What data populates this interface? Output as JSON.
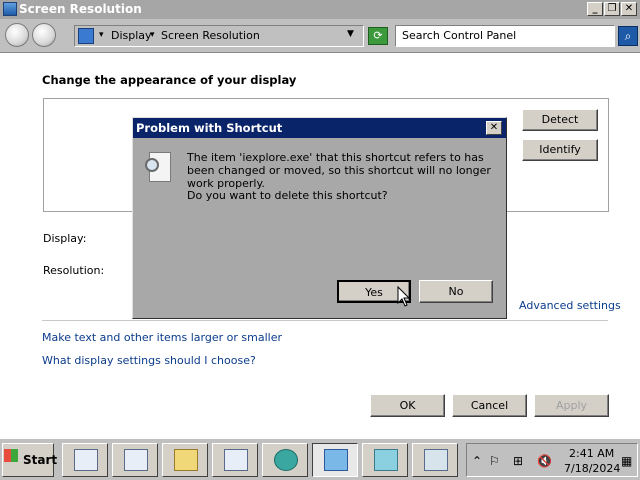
{
  "window": {
    "title": "Screen Resolution",
    "controls": {
      "minimize": "_",
      "maximize": "❐",
      "close": "✕"
    }
  },
  "toolbar": {
    "breadcrumb": [
      "Display",
      "Screen Resolution"
    ],
    "search_placeholder": "Search Control Panel"
  },
  "main": {
    "heading": "Change the appearance of your display",
    "detect_label": "Detect",
    "identify_label": "Identify",
    "display_label": "Display:",
    "resolution_label": "Resolution:",
    "advanced_link": "Advanced settings",
    "links": [
      "Make text and other items larger or smaller",
      "What display settings should I choose?"
    ],
    "ok_label": "OK",
    "cancel_label": "Cancel",
    "apply_label": "Apply"
  },
  "dialog": {
    "title": "Problem with Shortcut",
    "close": "✕",
    "message": "The item 'iexplore.exe' that this shortcut refers to has been changed or moved, so this shortcut will no longer work properly.",
    "question": "Do you want to delete this shortcut?",
    "yes_label": "Yes",
    "no_label": "No"
  },
  "taskbar": {
    "start_label": "Start",
    "time": "2:41 AM",
    "date": "7/18/2024"
  },
  "colors": {
    "titlebar": "#a6a6a6",
    "dialog_titlebar": "#0a246a",
    "link": "#0b3c8c"
  }
}
